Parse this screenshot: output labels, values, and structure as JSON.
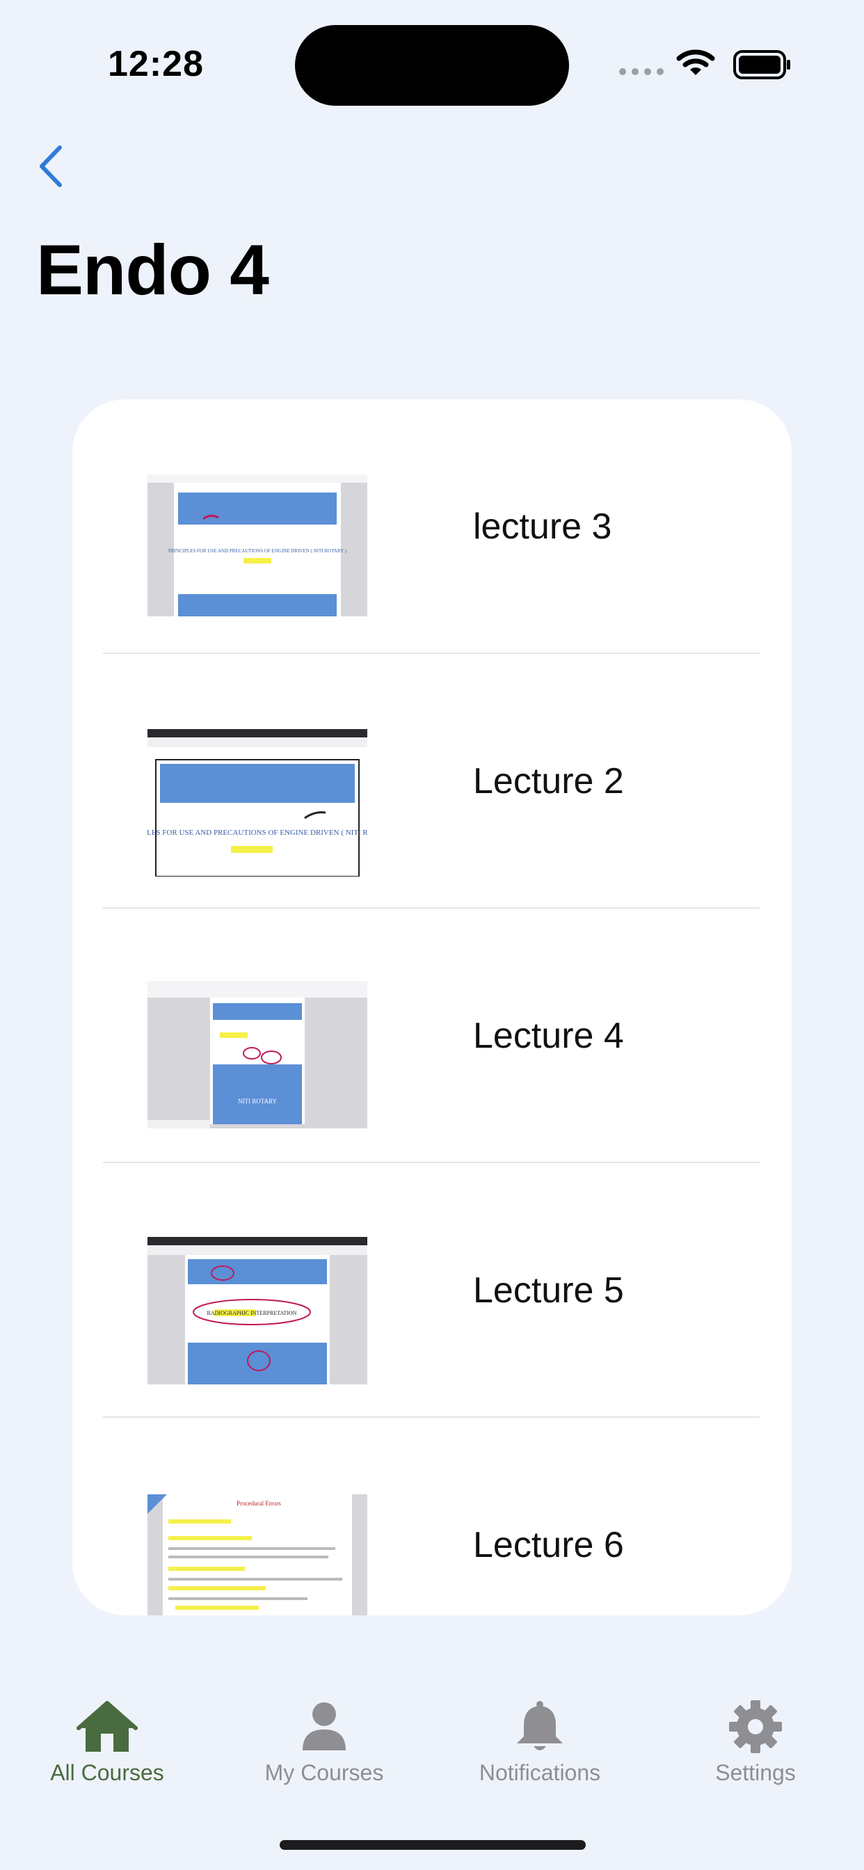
{
  "status_bar": {
    "time": "12:28"
  },
  "header": {
    "title": "Endo 4"
  },
  "lectures": [
    {
      "label": "lecture 3",
      "thumb_text": "PRINCIPLES FOR USE AND PRECAUTIONS OF ENGINE DRIVEN ( NITI ROTARY )"
    },
    {
      "label": "Lecture 2",
      "thumb_text": "PRINCIPLES FOR USE AND PRECAUTIONS OF ENGINE DRIVEN ( NITI ROTARY )"
    },
    {
      "label": "Lecture 4",
      "thumb_text": "NITI ROTARY"
    },
    {
      "label": "Lecture 5",
      "thumb_text": "RADIOGRAPHIC INTERPRETATION"
    },
    {
      "label": "Lecture 6",
      "thumb_text": "Procedural Errors"
    }
  ],
  "tabs": [
    {
      "label": "All Courses",
      "icon": "house-icon",
      "active": true
    },
    {
      "label": "My Courses",
      "icon": "person-icon",
      "active": false
    },
    {
      "label": "Notifications",
      "icon": "bell-icon",
      "active": false
    },
    {
      "label": "Settings",
      "icon": "gear-icon",
      "active": false
    }
  ],
  "colors": {
    "background": "#eef3fb",
    "active_tab": "#4a6b3f",
    "inactive_tab": "#8e8e93",
    "back_chevron": "#2f7bd9"
  }
}
